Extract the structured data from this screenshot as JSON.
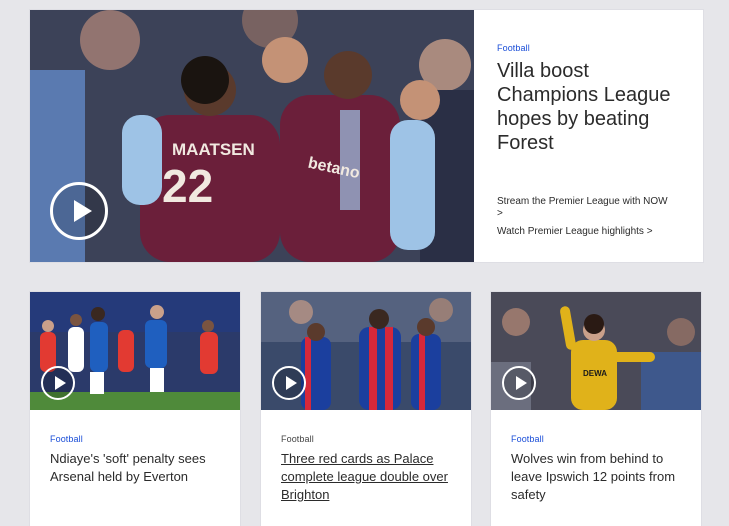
{
  "hero": {
    "category": "Football",
    "title": "Villa boost Champions League hopes by beating Forest",
    "links": [
      {
        "label": "Stream the Premier League with NOW",
        "chevron": ">"
      },
      {
        "label": "Watch Premier League highlights",
        "chevron": ">"
      }
    ],
    "image": {
      "shirt_name": "MAATSEN",
      "shirt_number": "22",
      "sponsor": "betano"
    },
    "icon": "play-icon"
  },
  "cards": [
    {
      "category": "Football",
      "title": "Ndiaye's 'soft' penalty sees Arsenal held by Everton",
      "icon": "play-icon"
    },
    {
      "category": "Football",
      "title": "Three red cards as Palace complete league double over Brighton",
      "icon": "play-icon"
    },
    {
      "category": "Football",
      "title": "Wolves win from behind to leave Ipswich 12 points from safety",
      "icon": "play-icon"
    }
  ],
  "colors": {
    "accent": "#1a4ed8",
    "background": "#e6e6ea",
    "villa_claret": "#6b1f3a",
    "villa_sky": "#9ec3e6"
  }
}
